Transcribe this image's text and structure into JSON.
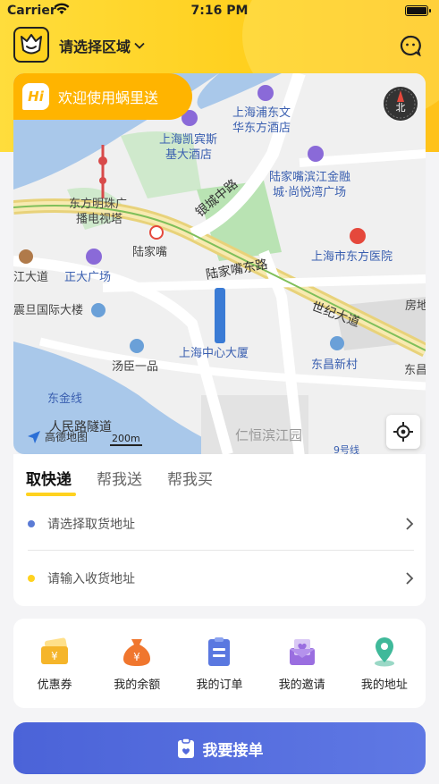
{
  "status_bar": {
    "carrier": "Carrier",
    "time": "7:16 PM"
  },
  "header": {
    "region": "请选择区域"
  },
  "map": {
    "welcome": "欢迎使用蜗里送",
    "hi_badge": "Hi",
    "compass_label": "北",
    "attribution": "高德地图",
    "scale": "200m",
    "labels": {
      "l1": "上海浦东文",
      "l2": "华东方酒店",
      "l3": "上海凯宾斯",
      "l4": "基大酒店",
      "l5": "陆家嘴滨江金融",
      "l6": "城·尚悦湾广场",
      "l7": "东方明珠广",
      "l8": "播电视塔",
      "l9": "银城中路",
      "l10": "陆家嘴",
      "l11": "上海市东方医院",
      "l12": "江大道",
      "l13": "正大广场",
      "l14": "陆家嘴东路",
      "l15": "震旦国际大楼",
      "l16": "世纪大道",
      "l17": "房地",
      "l18": "汤臣一品",
      "l19": "上海中心大厦",
      "l20": "东昌新村",
      "l21": "东昌",
      "l22": "东金线",
      "l23": "人民路隧道",
      "l24": "仁恒滨江园",
      "l25": "9号线"
    }
  },
  "delivery": {
    "tabs": [
      {
        "label": "取快递",
        "active": true
      },
      {
        "label": "帮我送",
        "active": false
      },
      {
        "label": "帮我买",
        "active": false
      }
    ],
    "pickup_placeholder": "请选择取货地址",
    "dropoff_placeholder": "请输入收货地址",
    "pickup_dot_color": "#5b7bd5",
    "dropoff_dot_color": "#ffd21f"
  },
  "services": [
    {
      "label": "优惠券",
      "icon": "coupon-icon"
    },
    {
      "label": "我的余额",
      "icon": "money-bag-icon"
    },
    {
      "label": "我的订单",
      "icon": "order-list-icon"
    },
    {
      "label": "我的邀请",
      "icon": "invite-icon"
    },
    {
      "label": "我的地址",
      "icon": "location-pin-icon"
    }
  ],
  "order_button": "我要接单",
  "colors": {
    "accent": "#ffd21f",
    "primary": "#5269dc"
  }
}
